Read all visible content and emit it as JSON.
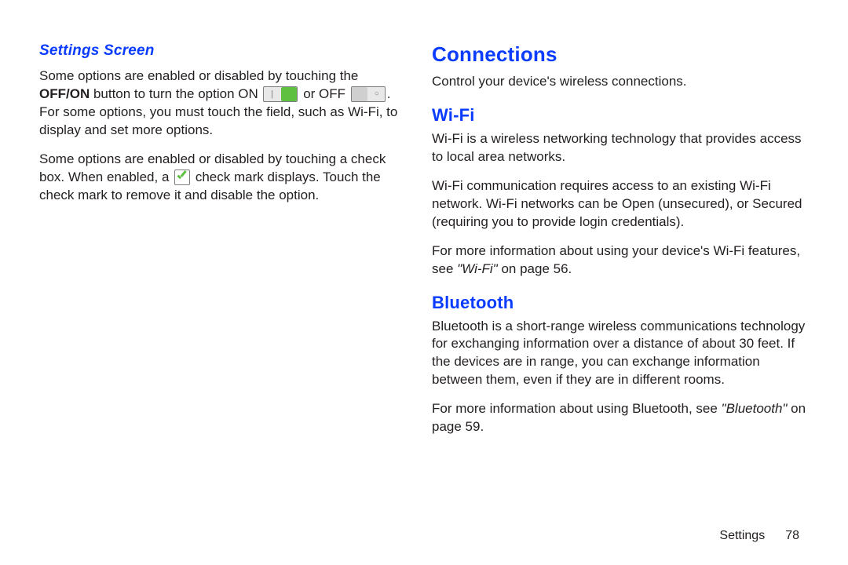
{
  "left": {
    "heading": "Settings Screen",
    "p1_a": "Some options are enabled or disabled by touching the ",
    "p1_bold": "OFF/ON",
    "p1_b": " button to turn the option ON ",
    "p1_c": " or OFF ",
    "p1_d": ". For some options, you must touch the field, such as Wi-Fi, to display and set more options.",
    "p2_a": "Some options are enabled or disabled by touching a check box. When enabled, a ",
    "p2_b": " check mark displays. Touch the check mark to remove it and disable the option."
  },
  "right": {
    "connections_h": "Connections",
    "connections_p": "Control your device's wireless connections.",
    "wifi_h": "Wi-Fi",
    "wifi_p1": "Wi-Fi is a wireless networking technology that provides access to local area networks.",
    "wifi_p2": "Wi-Fi communication requires access to an existing Wi-Fi network. Wi-Fi networks can be Open (unsecured), or Secured (requiring you to provide login credentials).",
    "wifi_p3_a": "For more information about using your device's Wi-Fi features, see ",
    "wifi_p3_ref": "\"Wi-Fi\"",
    "wifi_p3_b": " on page 56.",
    "bt_h": "Bluetooth",
    "bt_p1": "Bluetooth is a short-range wireless communications technology for exchanging information over a distance of about 30 feet. If the devices are in range, you can exchange information between them, even if they are in different rooms.",
    "bt_p2_a": "For more information about using Bluetooth, see ",
    "bt_p2_ref": "\"Bluetooth\"",
    "bt_p2_b": " on page 59."
  },
  "footer": {
    "section": "Settings",
    "page": "78"
  }
}
